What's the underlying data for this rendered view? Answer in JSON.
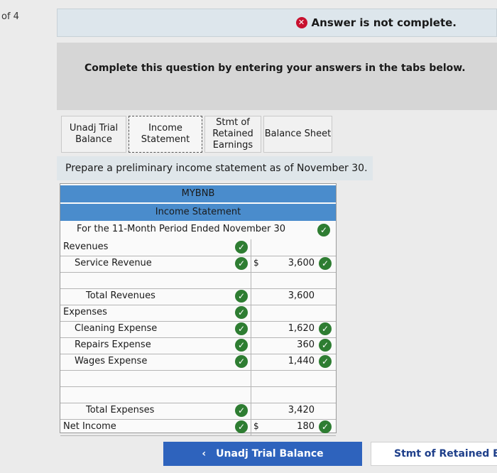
{
  "page_count": "of 4",
  "status": {
    "text": "Answer is not complete.",
    "color": "#c8102e",
    "icon": "x-circle-icon"
  },
  "instructions": "Complete this question by entering your answers in the tabs below.",
  "tabs": [
    {
      "label": "Unadj Trial\nBalance",
      "active": false
    },
    {
      "label": "Income\nStatement",
      "active": true
    },
    {
      "label": "Stmt of\nRetained\nEarnings",
      "active": false
    },
    {
      "label": "Balance Sheet",
      "active": false
    }
  ],
  "prompt": "Prepare a preliminary income statement as of November 30.",
  "statement": {
    "company": "MYBNB",
    "title": "Income Statement",
    "period": "For the 11-Month Period Ended November 30",
    "rows": [
      {
        "label": "Revenues",
        "indent": 0,
        "amount": "",
        "dollar": ""
      },
      {
        "label": "Service Revenue",
        "indent": 1,
        "amount": "3,600",
        "dollar": "$"
      },
      {
        "label": "",
        "indent": 1,
        "amount": "",
        "dollar": ""
      },
      {
        "label": "Total Revenues",
        "indent": 2,
        "amount": "3,600",
        "dollar": ""
      },
      {
        "label": "Expenses",
        "indent": 0,
        "amount": "",
        "dollar": ""
      },
      {
        "label": "Cleaning Expense",
        "indent": 1,
        "amount": "1,620",
        "dollar": ""
      },
      {
        "label": "Repairs Expense",
        "indent": 1,
        "amount": "360",
        "dollar": ""
      },
      {
        "label": "Wages Expense",
        "indent": 1,
        "amount": "1,440",
        "dollar": ""
      },
      {
        "label": "",
        "indent": 1,
        "amount": "",
        "dollar": ""
      },
      {
        "label": "",
        "indent": 1,
        "amount": "",
        "dollar": ""
      },
      {
        "label": "Total Expenses",
        "indent": 2,
        "amount": "3,420",
        "dollar": ""
      },
      {
        "label": "Net Income",
        "indent": 0,
        "amount": "180",
        "dollar": "$"
      }
    ]
  },
  "nav": {
    "prev_label": "Unadj Trial Balance",
    "next_label": "Stmt of Retained Earn"
  }
}
